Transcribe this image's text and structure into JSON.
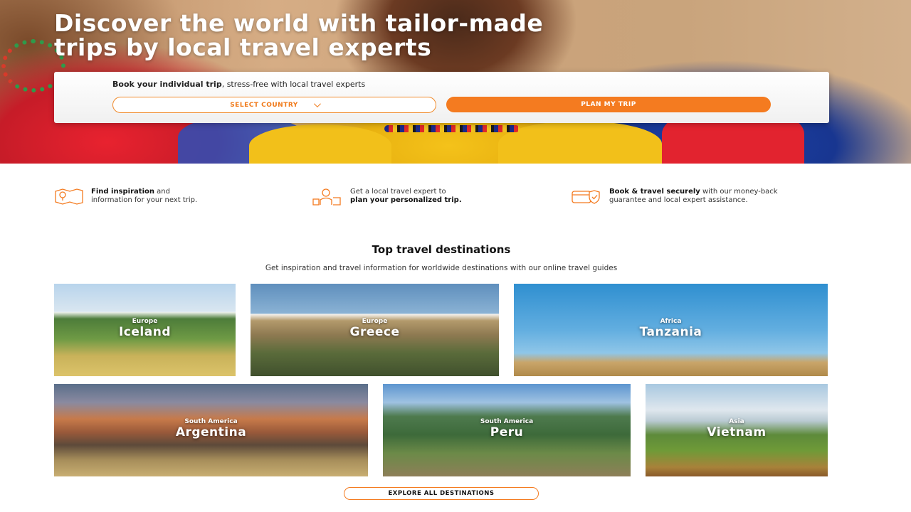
{
  "hero": {
    "title_line1": "Discover the world with tailor-made",
    "title_line2": "trips by local travel experts"
  },
  "booking": {
    "text_bold": "Book your individual trip",
    "text_rest": ", stress-free with local travel experts",
    "country_select_label": "SELECT COUNTRY",
    "plan_button_label": "PLAN MY TRIP"
  },
  "features": [
    {
      "icon": "map-icon",
      "pre": "",
      "bold": "Find inspiration",
      "post": " and",
      "line2_pre": "information for your next trip.",
      "line2_bold": "",
      "line2_post": ""
    },
    {
      "icon": "travel-expert-icon",
      "pre": "Get a local travel expert to",
      "bold": "",
      "post": "",
      "line2_pre": "",
      "line2_bold": "plan your personalized trip.",
      "line2_post": ""
    },
    {
      "icon": "secure-payment-icon",
      "pre": "",
      "bold": "Book & travel securely",
      "post": " with our money-back",
      "line2_pre": "guarantee and local expert assistance.",
      "line2_bold": "",
      "line2_post": ""
    }
  ],
  "destinations": {
    "title": "Top travel destinations",
    "subtitle": "Get inspiration and travel information for worldwide destinations with our online travel guides",
    "cards": [
      {
        "region": "Europe",
        "name": "Iceland"
      },
      {
        "region": "Europe",
        "name": "Greece"
      },
      {
        "region": "Africa",
        "name": "Tanzania"
      },
      {
        "region": "South America",
        "name": "Argentina"
      },
      {
        "region": "South America",
        "name": "Peru"
      },
      {
        "region": "Asia",
        "name": "Vietnam"
      }
    ],
    "explore_button_label": "EXPLORE ALL DESTINATIONS"
  },
  "colors": {
    "accent_orange": "#f47b20",
    "text_dark": "#111111"
  }
}
